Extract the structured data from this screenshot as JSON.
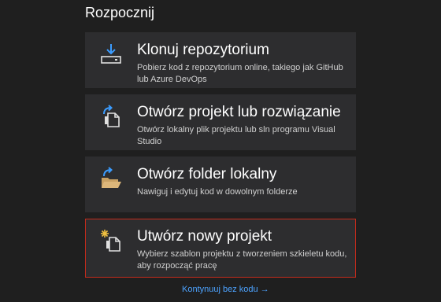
{
  "section": {
    "title": "Rozpocznij"
  },
  "cards": [
    {
      "id": "clone",
      "title": "Klonuj repozytorium",
      "description": "Pobierz kod z repozytorium online, takiego jak GitHub lub Azure DevOps",
      "icon": "clone-repository-icon"
    },
    {
      "id": "open-project",
      "title": "Otwórz projekt lub rozwiązanie",
      "description": "Otwórz lokalny plik projektu lub sln programu Visual Studio",
      "icon": "open-project-icon"
    },
    {
      "id": "open-folder",
      "title": "Otwórz folder lokalny",
      "description": "Nawiguj i edytuj kod w dowolnym folderze",
      "icon": "open-folder-icon"
    },
    {
      "id": "new-project",
      "title": "Utwórz nowy projekt",
      "description": "Wybierz szablon projektu z tworzeniem szkieletu kodu, aby rozpocząć pracę",
      "icon": "new-project-icon",
      "selected": true
    }
  ],
  "continue_link": {
    "label": "Kontynuuj bez kodu →"
  },
  "colors": {
    "background": "#1f1f1f",
    "card": "#2d2d2f",
    "selected_border": "#c42b1c",
    "link": "#4da3ff",
    "icon_blue": "#3b9cff",
    "icon_folder": "#dcb67a"
  }
}
